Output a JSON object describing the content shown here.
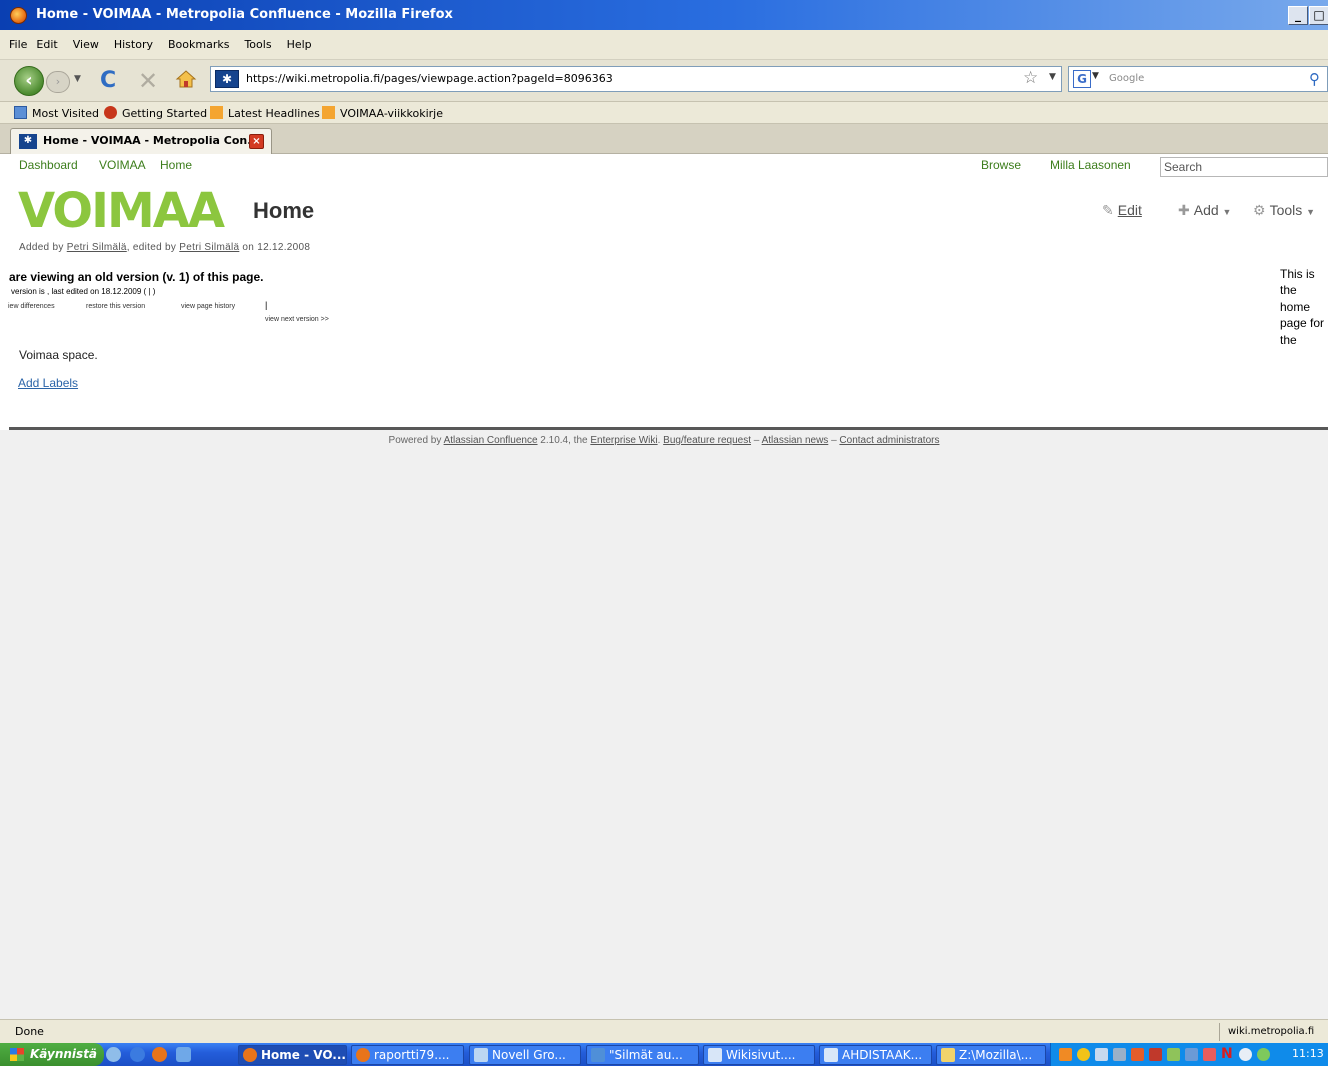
{
  "window": {
    "title": "Home - VOIMAA - Metropolia Confluence - Mozilla Firefox",
    "minimize": "_",
    "maximize": "□",
    "close": "×"
  },
  "menu": [
    "File",
    "Edit",
    "View",
    "History",
    "Bookmarks",
    "Tools",
    "Help"
  ],
  "nav": {
    "url": "https://wiki.metropolia.fi/pages/viewpage.action?pageId=8096363",
    "search_engine": "G",
    "search_placeholder": "Google"
  },
  "bookmarks": [
    "Most Visited",
    "Getting Started",
    "Latest Headlines",
    "VOIMAA-viikkokirje"
  ],
  "tab": {
    "label": "Home - VOIMAA - Metropolia Con...",
    "close": "×"
  },
  "page": {
    "toplinks": {
      "dashboard": "Dashboard",
      "space": "VOIMAA",
      "home": "Home"
    },
    "browse": "Browse",
    "user": "Milla Laasonen",
    "search_placeholder": "Search",
    "logo": "VOIMAA",
    "title": "Home",
    "actions": {
      "edit": "Edit",
      "add": "Add",
      "tools": "Tools"
    },
    "byline": {
      "added_by_prefix": "Added by ",
      "author": "Petri Silmälä",
      "edited_by": ", edited by ",
      "editor": "Petri Silmälä",
      "date_text": " on 12.12.2008"
    },
    "old_version": {
      "title": "are viewing an old version (v. 1) of this page.",
      "meta": "version is , last edited on 18.12.2009 ( | )",
      "links": [
        "iew differences",
        "restore this version",
        "view page history"
      ],
      "separator": "|",
      "next": "view next version >>"
    },
    "space_description": "Voimaa space.",
    "add_labels": "Add Labels",
    "side_note": "This is the home page for the",
    "footer": {
      "powered_by": "Powered by ",
      "confluence": "Atlassian Confluence",
      "version_text": " 2.10.4, the ",
      "enterprise": "Enterprise Wiki",
      "sep1": ". ",
      "bug": "Bug/feature request",
      "sep2": " – ",
      "news": "Atlassian news",
      "sep3": " – ",
      "contact": "Contact administrators"
    }
  },
  "status": {
    "text": "Done",
    "host": "wiki.metropolia.fi"
  },
  "taskbar": {
    "start": "Käynnistä",
    "tasks": [
      "Home - VO...",
      "raportti79....",
      "Novell Gro...",
      "\"Silmät au...",
      "Wikisivut....",
      "AHDISTAAK...",
      "Z:\\Mozilla\\..."
    ],
    "clock": "11:13"
  },
  "colors": {
    "accent_green": "#8cc63f",
    "link_green": "#3c7d1b",
    "link_blue": "#2b64a8",
    "titlebar": "#0a3fb2"
  }
}
